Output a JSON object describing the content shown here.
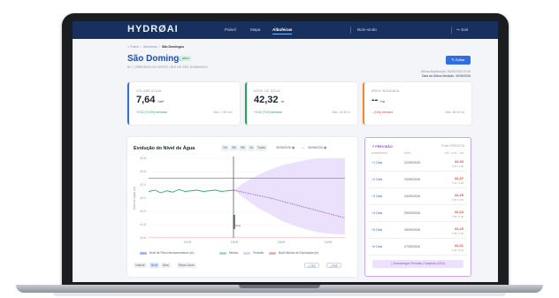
{
  "nav": {
    "logo": "HYDRØAI",
    "items": [
      "Painel",
      "Mapa",
      "Albufeiras"
    ],
    "user": "Bom-vindo",
    "logout": "Sair"
  },
  "breadcrumb": {
    "home": "Painel",
    "section": "Albufeiras",
    "current": "São Domingos"
  },
  "header": {
    "title": "São Domingos",
    "badge": "ativo",
    "subtitle": "ID 7 | RIBEIRAS DO OESTE | RIO DE SÃO DOMINGOS",
    "edit_label": "Editar",
    "meta1": "Última Atualização: 30/05/2026 23:45",
    "meta2": "Data da Última Medição: 30/05/2026"
  },
  "kpis": [
    {
      "label": "VOLUME ATUAL",
      "value": "7,64",
      "unit": "hm³",
      "delta": "+0.02 (+0.3%) semana",
      "max": "Máx: 7,85 hm³"
    },
    {
      "label": "NÍVEL DE ÁGUA",
      "value": "42,32",
      "unit": "m",
      "delta": "+0.02 (+0.0) semana",
      "max": "Máx: 42,50 m"
    },
    {
      "label": "ÁREA INUNDADA",
      "value": "--",
      "unit": "ha",
      "delta": "-- (N/A) semana",
      "max": "Máx: 86,00 ha"
    }
  ],
  "chart": {
    "title": "Evolução do Nível de Água",
    "ranges": [
      "1M",
      "3M",
      "6M",
      "1A",
      "Todos"
    ],
    "date_from": "30/04/2026",
    "date_to": "06/06/2026",
    "legend": [
      "Nível de Pleno Armazenamento (m)",
      "Medido",
      "Previsão",
      "Nivel Mínimo de Exploração (m)"
    ],
    "toggles": [
      "Volume",
      "Nível",
      "Área"
    ],
    "reset_label": "Repor Zoom",
    "csv_label": "CSV",
    "pdf_label": "PDF",
    "today_label": "Hoje"
  },
  "chart_data": {
    "type": "line",
    "ylabel": "Nível de Água (m)",
    "y_ticks": [
      "42,8",
      "42,6",
      "42,4",
      "42,2",
      "42,0",
      "41,8",
      "41,6"
    ],
    "ylim": [
      41.6,
      42.8
    ],
    "x_ticks": [
      "01/05",
      "15/05",
      "29/05",
      "12/06"
    ],
    "npa_level": 42.5,
    "min_level": 41.6,
    "series": [
      {
        "name": "Medido",
        "values": [
          42.3,
          42.32,
          42.28,
          42.31,
          42.29,
          42.33,
          42.3,
          42.31,
          42.32,
          42.3,
          42.31,
          42.32,
          42.3,
          42.31,
          42.32
        ]
      },
      {
        "name": "Previsão",
        "values": [
          42.32,
          42.28,
          42.24,
          42.2,
          42.15,
          42.1,
          42.05,
          42.0,
          41.95,
          41.9
        ]
      }
    ],
    "forecast_upper": [
      42.32,
      42.45,
      42.55,
      42.63,
      42.7,
      42.74,
      42.78,
      42.8,
      42.8,
      42.8
    ],
    "forecast_lower": [
      42.32,
      42.18,
      42.05,
      41.95,
      41.85,
      41.78,
      41.72,
      41.68,
      41.66,
      41.65
    ]
  },
  "forecast": {
    "title": "PREVISÃO",
    "source": "Fonte: PREDICTA",
    "headers": [
      "HORIZONTE",
      "DATA",
      "NÍV. / VOL. / ÁR."
    ],
    "rows": [
      {
        "day": "+1 Dias",
        "date": "22/05/2026",
        "level": "42,33",
        "sub": "7,64 / 0,00"
      },
      {
        "day": "+2 Dias",
        "date": "23/05/2026",
        "level": "42,27",
        "sub": "7,61 / 0,00"
      },
      {
        "day": "+3 Dias",
        "date": "24/05/2026",
        "level": "42,25",
        "sub": "7,60 / 0,00"
      },
      {
        "day": "+4 Dias",
        "date": "25/05/2026",
        "level": "42,24",
        "sub": "7,59 / 0,00"
      },
      {
        "day": "+5 Dias",
        "date": "26/05/2026",
        "level": "42,23",
        "sub": "7,58 / 0,00"
      },
      {
        "day": "+6 Dias",
        "date": "27/05/2026",
        "level": "42,21",
        "sub": "7,56 / 0,00"
      }
    ],
    "download_label": "Descarregar Previsão Completa (CSV)"
  }
}
